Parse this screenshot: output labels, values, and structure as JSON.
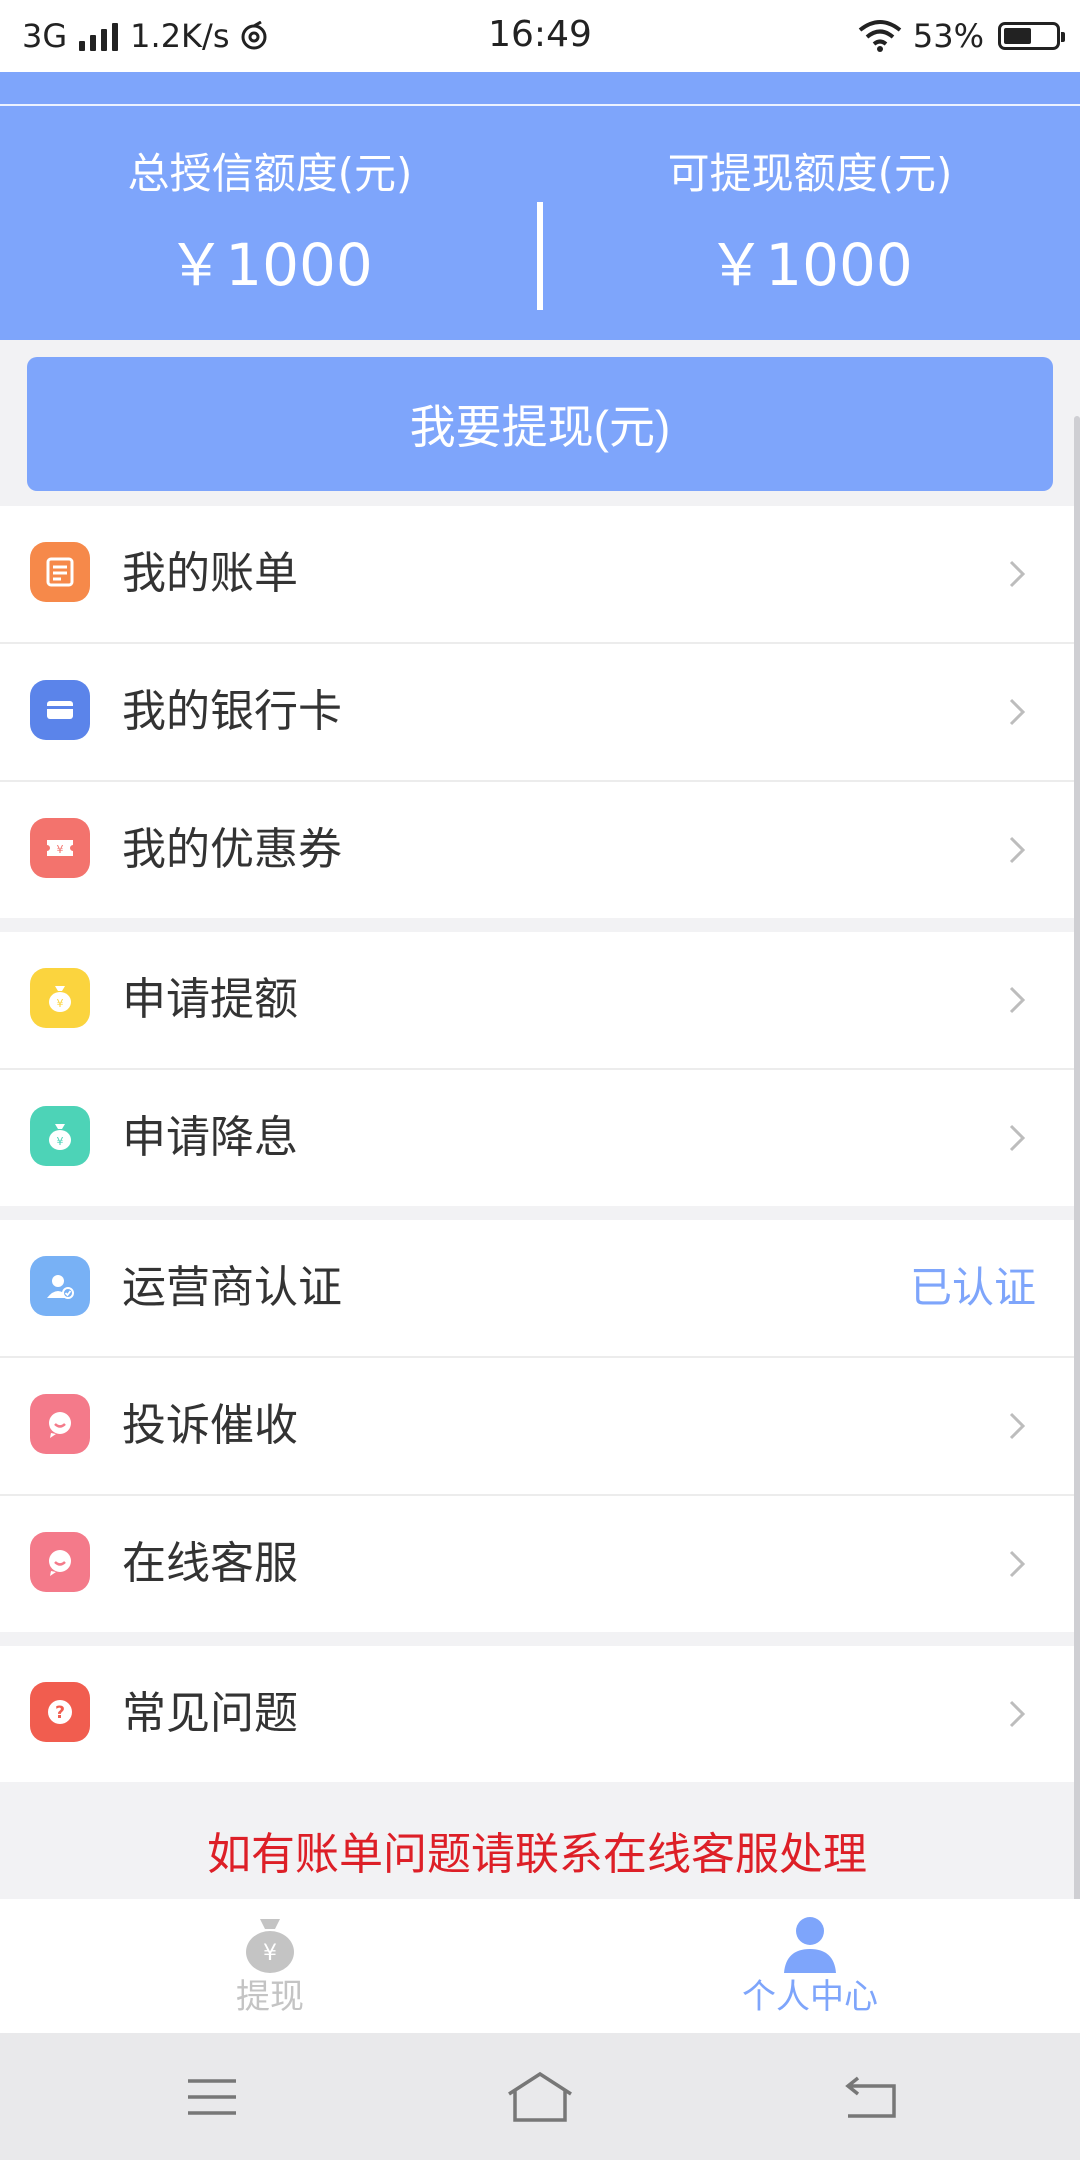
{
  "status_bar": {
    "network": "3G",
    "speed": "1.2K/s",
    "time": "16:49",
    "battery_text": "53%",
    "battery_level": 0.53
  },
  "header": {
    "left_label": "总授信额度(元)",
    "left_amount": "￥1000",
    "right_label": "可提现额度(元)",
    "right_amount": "￥1000",
    "bg_color": "#7ea5fb"
  },
  "withdraw_button": {
    "label": "我要提现(元)"
  },
  "menu": [
    {
      "label": "我的账单",
      "icon": "bill-icon",
      "color": "#f6894a"
    },
    {
      "label": "我的银行卡",
      "icon": "bank-card-icon",
      "color": "#5b84ea"
    },
    {
      "label": "我的优惠券",
      "icon": "coupon-icon",
      "color": "#f3736d"
    },
    {
      "label": "申请提额",
      "icon": "money-bag-icon",
      "color": "#fbd43e"
    },
    {
      "label": "申请降息",
      "icon": "money-bag-icon",
      "color": "#4dd3b7"
    },
    {
      "label": "运营商认证",
      "icon": "user-verify-icon",
      "color": "#78b1f5",
      "status": "已认证"
    },
    {
      "label": "投诉催收",
      "icon": "chat-icon",
      "color": "#f47a8a"
    },
    {
      "label": "在线客服",
      "icon": "chat-icon",
      "color": "#f47a8a"
    },
    {
      "label": "常见问题",
      "icon": "question-icon",
      "color": "#f15d4f"
    }
  ],
  "notice": "如有账单问题请联系在线客服处理",
  "tabs": [
    {
      "label": "提现",
      "icon": "money-bag-icon",
      "active": false
    },
    {
      "label": "个人中心",
      "icon": "person-icon",
      "active": true
    }
  ],
  "colors": {
    "accent": "#7ea5fb",
    "notice": "#dd1f27",
    "inactive_tab": "#c4c4c4"
  }
}
